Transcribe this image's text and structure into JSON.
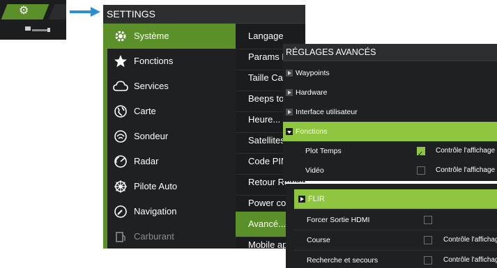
{
  "settings": {
    "title": "SETTINGS",
    "categories": [
      {
        "label": "Système",
        "icon": "gear-icon",
        "active": true
      },
      {
        "label": "Fonctions",
        "icon": "star-icon"
      },
      {
        "label": "Services",
        "icon": "cloud-icon"
      },
      {
        "label": "Carte",
        "icon": "globe-icon"
      },
      {
        "label": "Sondeur",
        "icon": "sonar-icon"
      },
      {
        "label": "Radar",
        "icon": "radar-icon"
      },
      {
        "label": "Pilote Auto",
        "icon": "helm-wheel-icon"
      },
      {
        "label": "Navigation",
        "icon": "compass-icon"
      },
      {
        "label": "Carburant",
        "icon": "fuel-icon"
      }
    ],
    "submenu": [
      {
        "label": "Langage"
      },
      {
        "label": "Params Boîtier"
      },
      {
        "label": "Taille Caractères"
      },
      {
        "label": "Beeps touches"
      },
      {
        "label": "Heure..."
      },
      {
        "label": "Satellites..."
      },
      {
        "label": "Code PIN..."
      },
      {
        "label": "Retour Réglages Usine"
      },
      {
        "label": "Power control"
      },
      {
        "label": "Avancé...",
        "active": true
      },
      {
        "label": "Mobile apps"
      }
    ]
  },
  "advanced": {
    "title": "RÉGLAGES AVANCÉS",
    "rows": [
      {
        "label": "Waypoints"
      },
      {
        "label": "Hardware"
      },
      {
        "label": "Interface utilisateur"
      },
      {
        "label": "Fonctions",
        "expanded": true
      }
    ],
    "options": [
      {
        "label": "Plot Temps",
        "checked": true,
        "description": "Contrôle l'affichage de"
      },
      {
        "label": "Vidéo",
        "checked": false,
        "description": "Contrôle l'affichage de"
      }
    ]
  },
  "flir": {
    "header": "FLIR",
    "options": [
      {
        "label": "Forcer Sortie HDMI",
        "checked": false,
        "description": ""
      },
      {
        "label": "Course",
        "checked": false,
        "description": "Contrôle l'affichage"
      },
      {
        "label": "Recherche et secours",
        "checked": false,
        "description": "Contrôle l'affichage"
      }
    ]
  },
  "colors": {
    "accent": "#5a8f29",
    "highlight": "#8ec640",
    "panel": "#1e2021",
    "pointer": "#2e8fd0"
  }
}
